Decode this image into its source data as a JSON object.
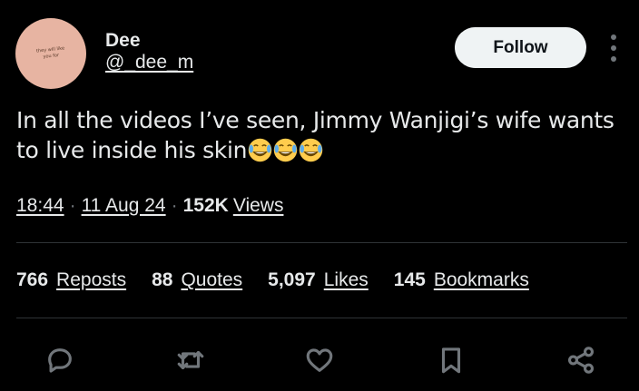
{
  "author": {
    "display_name": "Dee",
    "handle": "@_dee_m",
    "avatar_text": "they will like you for",
    "follow_label": "Follow"
  },
  "tweet": {
    "text": "In all the videos I’ve seen, Jimmy Wanjigi’s wife wants to live inside his skin",
    "emojis": [
      "laughing-tears",
      "laughing-tears",
      "laughing-tears"
    ]
  },
  "meta": {
    "time": "18:44",
    "date": "11 Aug 24",
    "views_count": "152K",
    "views_label": "Views"
  },
  "stats": [
    {
      "count": "766",
      "label": "Reposts"
    },
    {
      "count": "88",
      "label": "Quotes"
    },
    {
      "count": "5,097",
      "label": "Likes"
    },
    {
      "count": "145",
      "label": "Bookmarks"
    }
  ],
  "actions": [
    {
      "icon": "reply-icon"
    },
    {
      "icon": "repost-icon"
    },
    {
      "icon": "like-icon"
    },
    {
      "icon": "bookmark-icon"
    },
    {
      "icon": "share-icon"
    }
  ],
  "colors": {
    "background": "#000000",
    "text": "#e7e9ea",
    "muted": "#71767b",
    "divider": "#2f3336",
    "follow_bg": "#eff3f4"
  }
}
